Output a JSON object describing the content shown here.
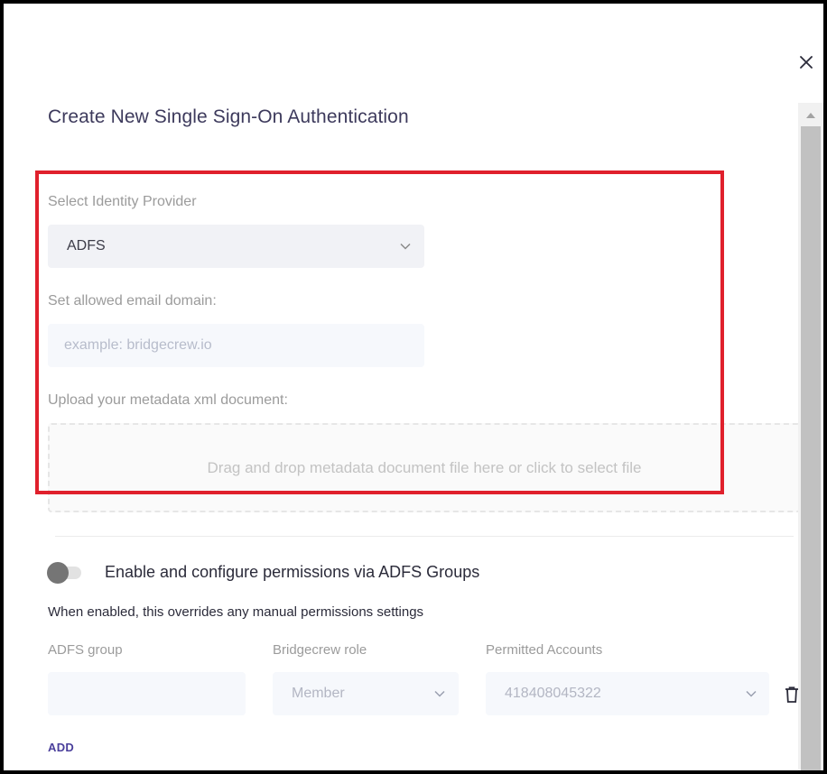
{
  "modal": {
    "title": "Create New Single Sign-On Authentication",
    "close_icon": "close-icon"
  },
  "identity_provider": {
    "label": "Select Identity Provider",
    "selected": "ADFS"
  },
  "email_domain": {
    "label": "Set allowed email domain:",
    "value": "",
    "placeholder": "example: bridgecrew.io"
  },
  "metadata_upload": {
    "label": "Upload your metadata xml document:",
    "dropzone_text": "Drag and drop metadata document file here or click to select file"
  },
  "group_permissions": {
    "toggle_enabled": false,
    "toggle_label": "Enable and configure permissions via ADFS Groups",
    "helper_text": "When enabled, this overrides any manual permissions settings",
    "columns": {
      "group": "ADFS group",
      "role": "Bridgecrew role",
      "accounts": "Permitted Accounts"
    },
    "row": {
      "group_value": "",
      "role_value": "Member",
      "accounts_value": "418408045322"
    },
    "add_label": "ADD"
  },
  "colors": {
    "highlight": "#e0202c",
    "accent": "#4a3f9b",
    "title": "#3d3a5c"
  }
}
